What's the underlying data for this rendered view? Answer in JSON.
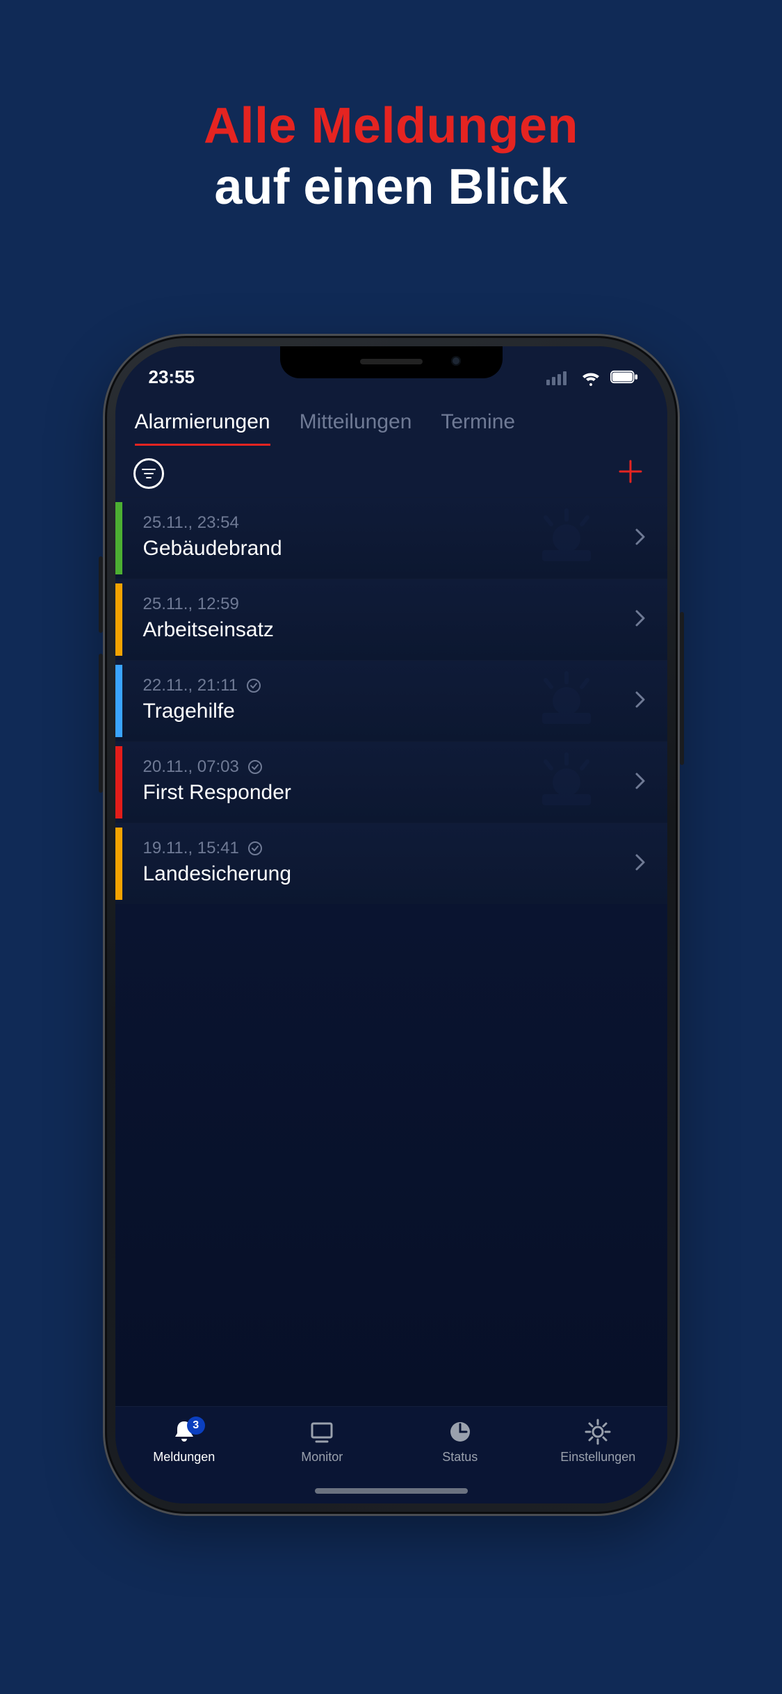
{
  "promo": {
    "line1": "Alle Meldungen",
    "line2": "auf einen Blick"
  },
  "ios_status": {
    "time": "23:55"
  },
  "tabs": [
    {
      "label": "Alarmierungen",
      "active": true
    },
    {
      "label": "Mitteilungen",
      "active": false
    },
    {
      "label": "Termine",
      "active": false
    }
  ],
  "list": [
    {
      "date": "25.11., 23:54",
      "title": "Gebäudebrand",
      "ack": false,
      "color": "green"
    },
    {
      "date": "25.11., 12:59",
      "title": "Arbeitseinsatz",
      "ack": false,
      "color": "orange"
    },
    {
      "date": "22.11., 21:11",
      "title": "Tragehilfe",
      "ack": true,
      "color": "blue"
    },
    {
      "date": "20.11., 07:03",
      "title": "First Responder",
      "ack": true,
      "color": "red"
    },
    {
      "date": "19.11., 15:41",
      "title": "Landesicherung",
      "ack": true,
      "color": "orange"
    }
  ],
  "nav": {
    "items": [
      {
        "label": "Meldungen",
        "icon": "bell",
        "active": true,
        "badge": "3"
      },
      {
        "label": "Monitor",
        "icon": "monitor",
        "active": false
      },
      {
        "label": "Status",
        "icon": "clock",
        "active": false
      },
      {
        "label": "Einstellungen",
        "icon": "gear",
        "active": false
      }
    ]
  }
}
